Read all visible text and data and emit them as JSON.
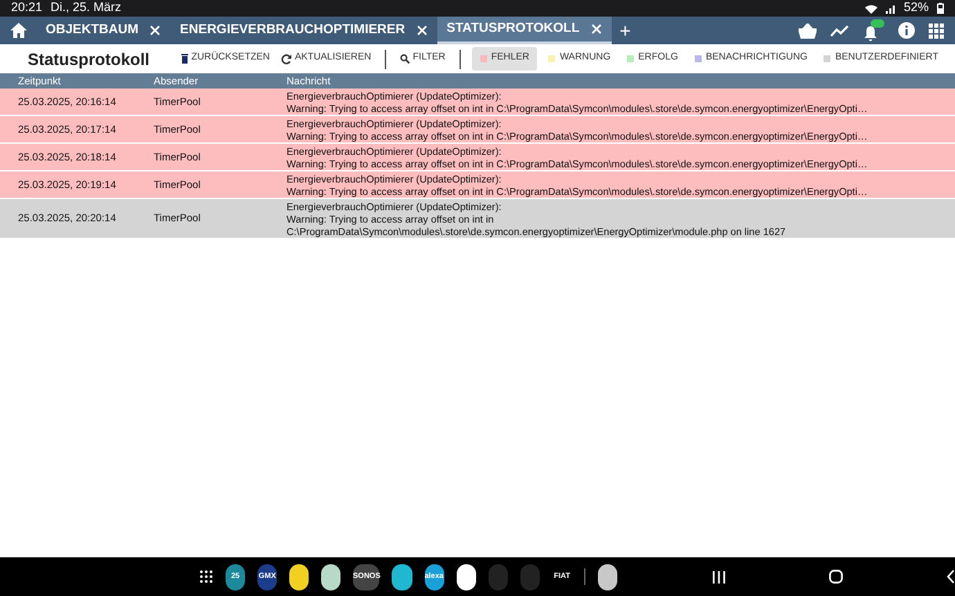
{
  "status_bar": {
    "time": "20:21",
    "date": "Di., 25. März",
    "battery": "52%"
  },
  "tabs": [
    {
      "label": "OBJEKTBAUM",
      "selected": false
    },
    {
      "label": "ENERGIEVERBRAUCHOPTIMIERER",
      "selected": false
    },
    {
      "label": "STATUSPROTOKOLL",
      "selected": true
    }
  ],
  "add_tab": "+",
  "page_title": "Statusprotokoll",
  "toolbar": [
    {
      "label": "ZURÜCKSETZEN",
      "kind": "reset"
    },
    {
      "label": "AKTUALISIEREN",
      "kind": "refresh"
    },
    {
      "label": "FILTER",
      "kind": "filter"
    }
  ],
  "filters": [
    {
      "label": "FEHLER",
      "selected": true,
      "color": "#f9b9bb"
    },
    {
      "label": "WARNUNG",
      "selected": false,
      "color": "#f7f3b0"
    },
    {
      "label": "ERFOLG",
      "selected": false,
      "color": "#b8ecb8"
    },
    {
      "label": "BENACHRICHTIGUNG",
      "selected": false,
      "color": "#b9b9e8"
    },
    {
      "label": "BENUTZERDEFINIERT",
      "selected": false,
      "color": "#d3d3d3"
    }
  ],
  "table": {
    "columns": [
      "Zeitpunkt",
      "Absender",
      "Nachricht"
    ],
    "rows": [
      {
        "time": "25.03.2025, 20:16:14",
        "sender": "TimerPool",
        "color": "#fdbcbe",
        "message": [
          "EnergieverbrauchOptimierer (UpdateOptimizer):",
          "Warning: Trying to access array offset on int in C:\\ProgramData\\Symcon\\modules\\.store\\de.symcon.energyoptimizer\\EnergyOpti…"
        ]
      },
      {
        "time": "25.03.2025, 20:17:14",
        "sender": "TimerPool",
        "color": "#fdbcbe",
        "message": [
          "EnergieverbrauchOptimierer (UpdateOptimizer):",
          "Warning: Trying to access array offset on int in C:\\ProgramData\\Symcon\\modules\\.store\\de.symcon.energyoptimizer\\EnergyOpti…"
        ]
      },
      {
        "time": "25.03.2025, 20:18:14",
        "sender": "TimerPool",
        "color": "#fdbcbe",
        "message": [
          "EnergieverbrauchOptimierer (UpdateOptimizer):",
          "Warning: Trying to access array offset on int in C:\\ProgramData\\Symcon\\modules\\.store\\de.symcon.energyoptimizer\\EnergyOpti…"
        ]
      },
      {
        "time": "25.03.2025, 20:19:14",
        "sender": "TimerPool",
        "color": "#fdbcbe",
        "message": [
          "EnergieverbrauchOptimierer (UpdateOptimizer):",
          "Warning: Trying to access array offset on int in C:\\ProgramData\\Symcon\\modules\\.store\\de.symcon.energyoptimizer\\EnergyOpti…"
        ]
      },
      {
        "time": "25.03.2025, 20:20:14",
        "sender": "TimerPool",
        "color": "#d4d4d4",
        "message": [
          "EnergieverbrauchOptimierer (UpdateOptimizer):",
          "Warning: Trying to access array offset on int in",
          "C:\\ProgramData\\Symcon\\modules\\.store\\de.symcon.energyoptimizer\\EnergyOptimizer\\module.php on line 1627"
        ]
      }
    ]
  },
  "dock": [
    {
      "kind": "grid"
    },
    {
      "kind": "app",
      "label": "25",
      "color": "#1c8a9a"
    },
    {
      "kind": "app",
      "label": "GMX",
      "color": "#1c3c8c"
    },
    {
      "kind": "app",
      "color": "#f0d020"
    },
    {
      "kind": "app",
      "color": "#b8d8c8"
    },
    {
      "kind": "app",
      "label": "SONOS",
      "color": "#444444"
    },
    {
      "kind": "app",
      "color": "#20b8d0"
    },
    {
      "kind": "app",
      "label": "alexa",
      "color": "#1aa0d8"
    },
    {
      "kind": "app",
      "color": "#ffffff"
    },
    {
      "kind": "app",
      "color": "#222222"
    },
    {
      "kind": "app",
      "color": "#222222"
    },
    {
      "kind": "app",
      "label": "FIAT",
      "color": "#000000"
    },
    {
      "kind": "divider"
    },
    {
      "kind": "app",
      "color": "#c8c8c8"
    }
  ]
}
